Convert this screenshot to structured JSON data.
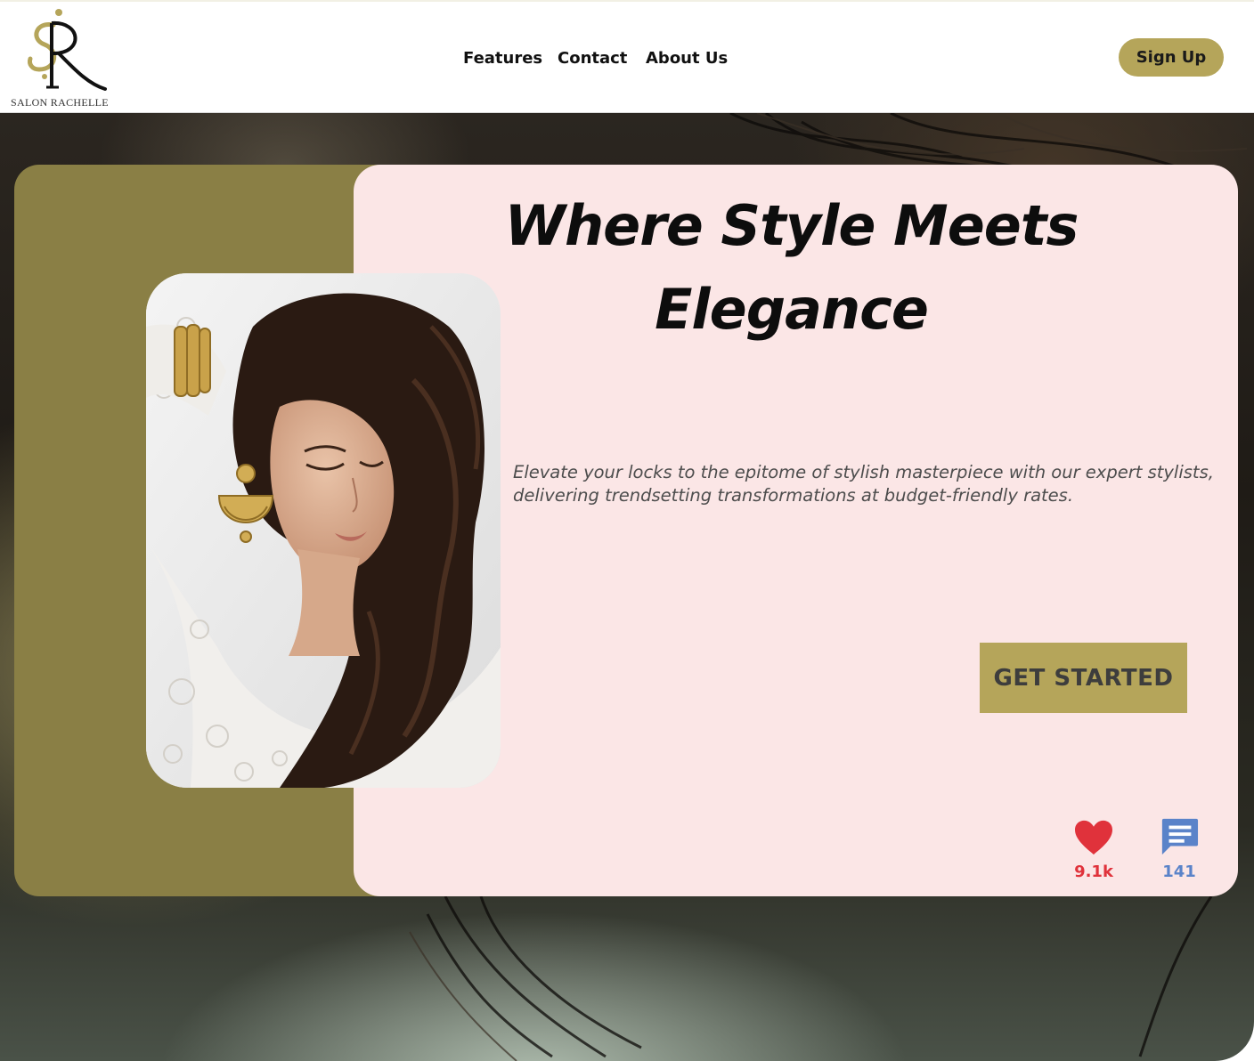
{
  "brand": {
    "logo_monogram": "SR",
    "name": "SALON RACHELLE"
  },
  "nav": {
    "items": [
      {
        "label": "Features"
      },
      {
        "label": "Contact"
      },
      {
        "label": "About Us"
      }
    ],
    "signup_label": "Sign Up"
  },
  "hero": {
    "headline_line1": "Where Style Meets",
    "headline_line2": "Elegance",
    "subtext": "Elevate your locks to the epitome of stylish masterpiece with our expert stylists, delivering trendsetting transformations at budget-friendly rates.",
    "cta_label": "GET STARTED"
  },
  "stats": {
    "likes": "9.1k",
    "comments": "141"
  },
  "colors": {
    "accent_gold": "#b5a55a",
    "olive_panel": "#8a7f45",
    "card_pink": "#fbe6e6",
    "like_red": "#e0323b",
    "comment_blue": "#5a83c9"
  }
}
